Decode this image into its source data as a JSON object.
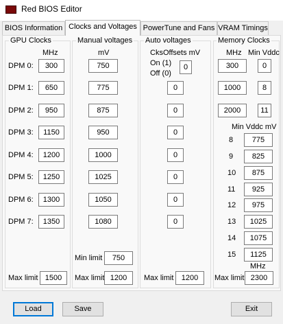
{
  "window": {
    "title": "Red BIOS Editor"
  },
  "tabs": [
    "BIOS Information",
    "Clocks and Voltages",
    "PowerTune and Fans",
    "VRAM Timings"
  ],
  "gpu_clocks": {
    "title": "GPU Clocks",
    "unit": "MHz",
    "labels": [
      "DPM 0:",
      "DPM 1:",
      "DPM 2:",
      "DPM 3:",
      "DPM 4:",
      "DPM 5:",
      "DPM 6:",
      "DPM 7:"
    ],
    "values": [
      "300",
      "650",
      "950",
      "1150",
      "1200",
      "1250",
      "1300",
      "1350"
    ],
    "max_label": "Max limit",
    "max_value": "1500"
  },
  "manual_voltages": {
    "title": "Manual voltages",
    "unit": "mV",
    "values": [
      "750",
      "775",
      "875",
      "950",
      "1000",
      "1025",
      "1050",
      "1080"
    ],
    "min_label": "Min limit",
    "min_value": "750",
    "max_label": "Max limit",
    "max_value": "1200"
  },
  "auto_voltages": {
    "title": "Auto voltages",
    "header": "CksOffsets mV",
    "on_label": "On (1)",
    "off_label": "Off (0)",
    "values": [
      "0",
      "0",
      "0",
      "0",
      "0",
      "0",
      "0",
      "0"
    ],
    "max_label": "Max limit",
    "max_value": "1200"
  },
  "memory_clocks": {
    "title": "Memory Clocks",
    "unit": "MHz",
    "vddc_header": "Min Vddc",
    "clocks": [
      "300",
      "1000",
      "2000"
    ],
    "vddc_indices": [
      "0",
      "8",
      "11"
    ],
    "table_header": "Min Vddc mV",
    "table_indices": [
      "8",
      "9",
      "10",
      "11",
      "12",
      "13",
      "14",
      "15"
    ],
    "table_values": [
      "775",
      "825",
      "875",
      "925",
      "975",
      "1025",
      "1075",
      "1125"
    ],
    "max_unit": "MHz",
    "max_label": "Max limit",
    "max_value": "2300"
  },
  "buttons": {
    "load": "Load",
    "save": "Save",
    "exit": "Exit"
  }
}
